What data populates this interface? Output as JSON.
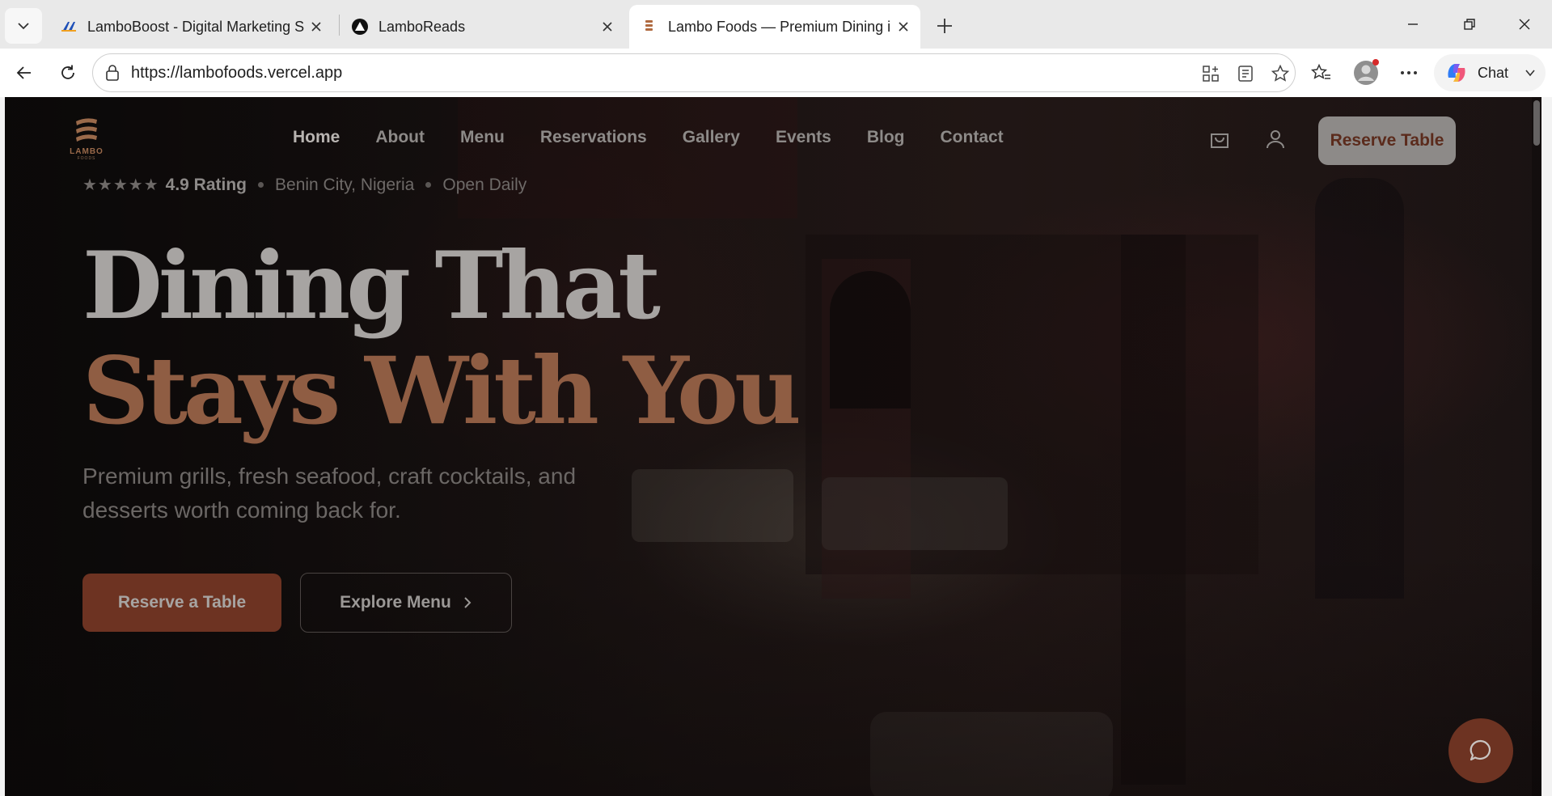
{
  "browser": {
    "tabs": [
      {
        "title": "LamboBoost - Digital Marketing Se",
        "favicon": "lamboboost-favicon",
        "active": false
      },
      {
        "title": "LamboReads",
        "favicon": "lamboreads-favicon",
        "active": false
      },
      {
        "title": "Lambo Foods — Premium Dining i",
        "favicon": "lambofoods-favicon",
        "active": true
      }
    ],
    "url": "https://lambofoods.vercel.app",
    "chat_label": "Chat"
  },
  "site": {
    "logo": {
      "text": "LAMBO",
      "sub": "FOODS"
    },
    "nav": [
      "Home",
      "About",
      "Menu",
      "Reservations",
      "Gallery",
      "Events",
      "Blog",
      "Contact"
    ],
    "active_nav": "Home",
    "reserve_button": "Reserve Table",
    "meta": {
      "stars": "★★★★★",
      "rating": "4.9 Rating",
      "location": "Benin City, Nigeria",
      "hours": "Open Daily"
    },
    "headline_line1": "Dining That",
    "headline_line2": "Stays With You",
    "subtitle": "Premium grills, fresh seafood, craft cocktails, and desserts worth coming back for.",
    "cta_primary": "Reserve a Table",
    "cta_secondary": "Explore Menu"
  },
  "colors": {
    "accent": "#6d3322",
    "headline_accent": "#8f5d43"
  }
}
